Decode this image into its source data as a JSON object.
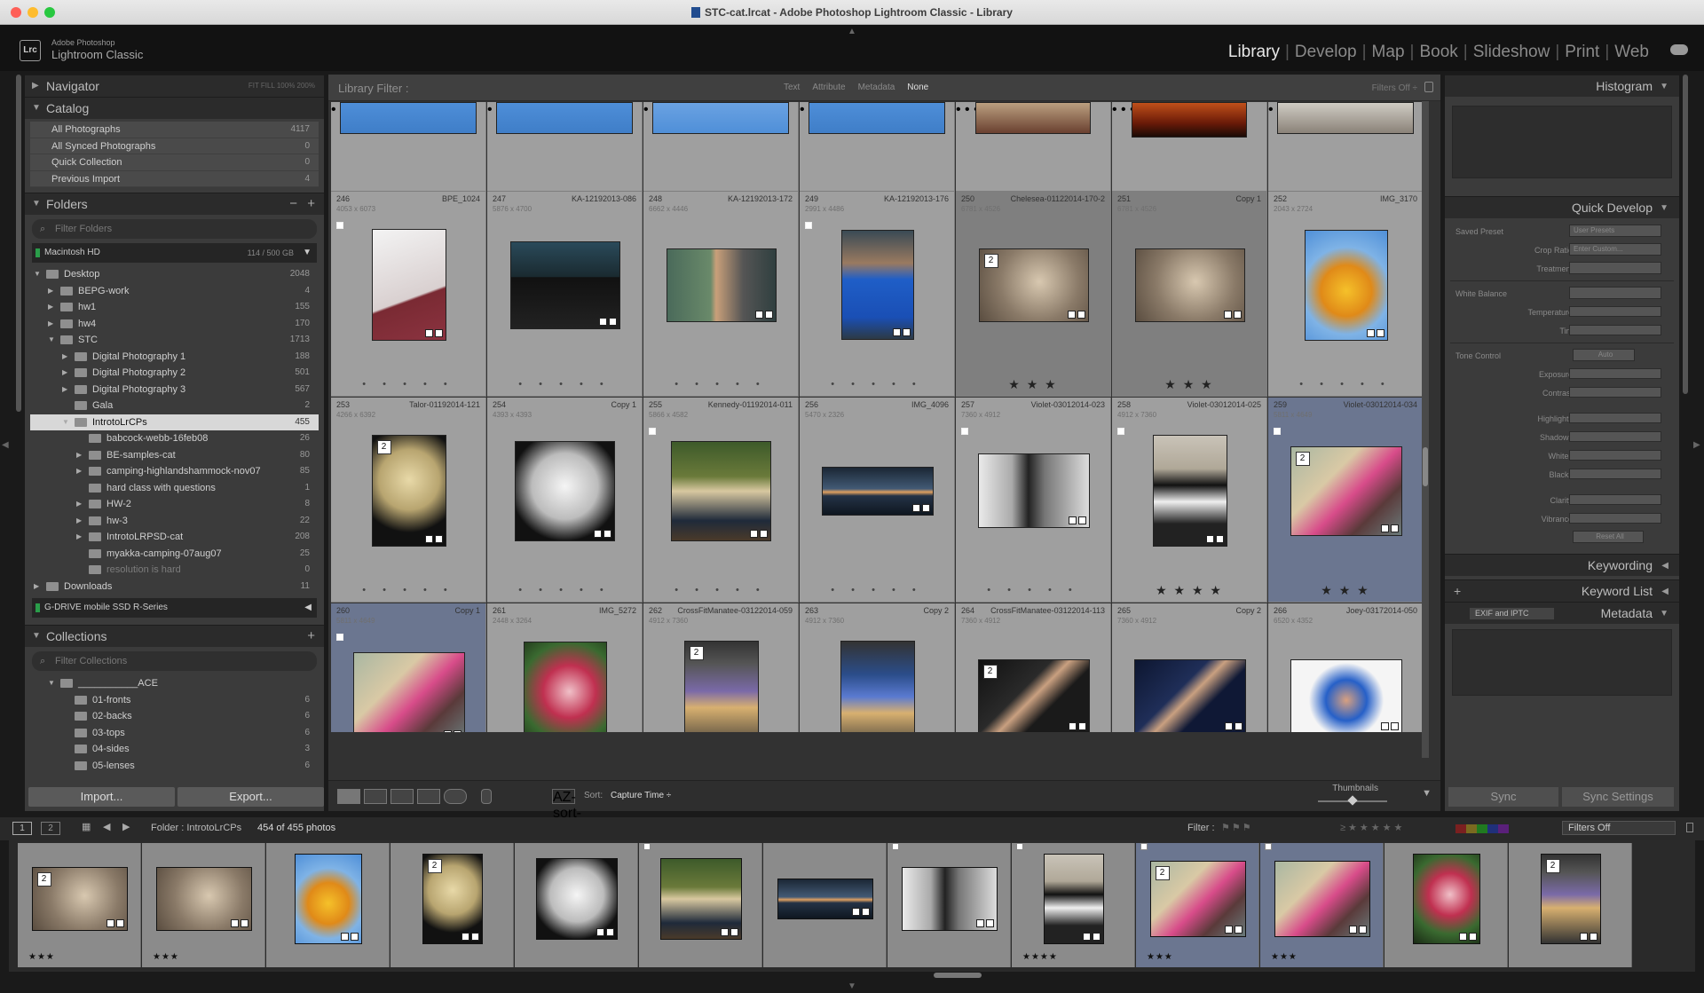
{
  "window": {
    "title": "STC-cat.lrcat - Adobe Photoshop Lightroom Classic - Library"
  },
  "brand": {
    "line1": "Adobe Photoshop",
    "line2": "Lightroom Classic",
    "logo": "Lrc"
  },
  "modules": [
    "Library",
    "Develop",
    "Map",
    "Book",
    "Slideshow",
    "Print",
    "Web"
  ],
  "active_module": "Library",
  "navigator": {
    "label": "Navigator",
    "modes": "FIT   FILL   100%   200%"
  },
  "catalog": {
    "label": "Catalog",
    "items": [
      {
        "label": "All Photographs",
        "count": "4117"
      },
      {
        "label": "All Synced Photographs",
        "count": "0"
      },
      {
        "label": "Quick Collection",
        "count": "0"
      },
      {
        "label": "Previous Import",
        "count": "4"
      }
    ]
  },
  "folders": {
    "label": "Folders",
    "filter_placeholder": "Filter Folders",
    "volume": {
      "name": "Macintosh HD",
      "usage": "114 / 500 GB"
    },
    "items": [
      {
        "label": "Desktop",
        "count": "2048",
        "indent": 0,
        "arrow": "▼"
      },
      {
        "label": "BEPG-work",
        "count": "4",
        "indent": 1,
        "arrow": "▶"
      },
      {
        "label": "hw1",
        "count": "155",
        "indent": 1,
        "arrow": "▶"
      },
      {
        "label": "hw4",
        "count": "170",
        "indent": 1,
        "arrow": "▶"
      },
      {
        "label": "STC",
        "count": "1713",
        "indent": 1,
        "arrow": "▼"
      },
      {
        "label": "Digital Photography 1",
        "count": "188",
        "indent": 2,
        "arrow": "▶"
      },
      {
        "label": "Digital Photography 2",
        "count": "501",
        "indent": 2,
        "arrow": "▶"
      },
      {
        "label": "Digital Photography 3",
        "count": "567",
        "indent": 2,
        "arrow": "▶"
      },
      {
        "label": "Gala",
        "count": "2",
        "indent": 2,
        "arrow": ""
      },
      {
        "label": "IntrotoLrCPs",
        "count": "455",
        "indent": 2,
        "arrow": "▼",
        "selected": true
      },
      {
        "label": "babcock-webb-16feb08",
        "count": "26",
        "indent": 3,
        "arrow": ""
      },
      {
        "label": "BE-samples-cat",
        "count": "80",
        "indent": 3,
        "arrow": "▶"
      },
      {
        "label": "camping-highlandshammock-nov07",
        "count": "85",
        "indent": 3,
        "arrow": "▶"
      },
      {
        "label": "hard class with questions",
        "count": "1",
        "indent": 3,
        "arrow": ""
      },
      {
        "label": "HW-2",
        "count": "8",
        "indent": 3,
        "arrow": "▶"
      },
      {
        "label": "hw-3",
        "count": "22",
        "indent": 3,
        "arrow": "▶"
      },
      {
        "label": "IntrotoLRPSD-cat",
        "count": "208",
        "indent": 3,
        "arrow": "▶"
      },
      {
        "label": "myakka-camping-07aug07",
        "count": "25",
        "indent": 3,
        "arrow": ""
      },
      {
        "label": "resolution is hard",
        "count": "0",
        "indent": 3,
        "arrow": "",
        "dim": true
      },
      {
        "label": "Downloads",
        "count": "11",
        "indent": 0,
        "arrow": "▶"
      }
    ],
    "volume2": {
      "name": "G-DRIVE mobile SSD R-Series"
    }
  },
  "collections": {
    "label": "Collections",
    "filter_placeholder": "Filter Collections",
    "items": [
      {
        "label": "___________ACE",
        "count": "",
        "indent": 0
      },
      {
        "label": "01-fronts",
        "count": "6",
        "indent": 1
      },
      {
        "label": "02-backs",
        "count": "6",
        "indent": 1
      },
      {
        "label": "03-tops",
        "count": "6",
        "indent": 1
      },
      {
        "label": "04-sides",
        "count": "3",
        "indent": 1
      },
      {
        "label": "05-lenses",
        "count": "6",
        "indent": 1
      }
    ]
  },
  "left_buttons": {
    "import": "Import...",
    "export": "Export..."
  },
  "library_filter": {
    "label": "Library Filter :",
    "tabs": [
      "Text",
      "Attribute",
      "Metadata",
      "None"
    ],
    "active_tab": "None",
    "right": "Filters Off ÷"
  },
  "grid": {
    "rows": [
      [
        {
          "num": "246",
          "name": "BPE_1024",
          "dims": "4053 x 6073",
          "stars": "",
          "flag": true,
          "badge": "",
          "thumb": {
            "w": 84,
            "h": 126,
            "bg": "linear-gradient(160deg,#f3f3f3,#d9d0d0 60%,#7a2a33 62%,#8b3340)"
          }
        },
        {
          "num": "247",
          "name": "KA-12192013-086",
          "dims": "5876 x 4700",
          "stars": "",
          "flag": false,
          "badge": "",
          "thumb": {
            "w": 124,
            "h": 99,
            "bg": "linear-gradient(180deg,#2a4a5a,#1a2a30 40%,#111 41%,#222)"
          }
        },
        {
          "num": "248",
          "name": "KA-12192013-172",
          "dims": "6662 x 4446",
          "stars": "",
          "flag": false,
          "badge": "",
          "thumb": {
            "w": 124,
            "h": 83,
            "bg": "linear-gradient(90deg,#4a6a5a,#6a8a6a 40%,#c9a07a 45%,#555 70%,#2f3f3f)"
          }
        },
        {
          "num": "249",
          "name": "KA-12192013-176",
          "dims": "2991 x 4486",
          "stars": "",
          "flag": true,
          "badge": "",
          "thumb": {
            "w": 82,
            "h": 124,
            "bg": "linear-gradient(180deg,#3a4a55,#9a7a60 30%,#1f5ec7 45%,#1a4fb5 80%,#2c3a45)"
          }
        },
        {
          "num": "250",
          "name": "Chelesea-01122014-170-2",
          "dims": "6781 x 4526",
          "stars": "★ ★ ★",
          "flag": false,
          "badge": "2",
          "sel": true,
          "thumb": {
            "w": 124,
            "h": 83,
            "bg": "radial-gradient(circle at 55% 45%,#d8c8b0,#8a7a68 55%,#5a4d40)"
          }
        },
        {
          "num": "251",
          "name": "Copy 1",
          "dims": "6781 x 4526",
          "stars": "★ ★ ★",
          "flag": false,
          "badge": "",
          "sel": true,
          "thumb": {
            "w": 124,
            "h": 83,
            "bg": "radial-gradient(circle at 55% 45%,#d8c8b0,#8a7a68 55%,#5a4d40)"
          }
        },
        {
          "num": "252",
          "name": "IMG_3170",
          "dims": "2043 x 2724",
          "stars": "",
          "flag": false,
          "badge": "",
          "thumb": {
            "w": 94,
            "h": 125,
            "bg": "radial-gradient(circle at 50% 55%,#f5c12a,#e08a18 35%,#7fb3e6 60%,#4f8fd8)"
          }
        }
      ],
      [
        {
          "num": "253",
          "name": "Talor-01192014-121",
          "dims": "4266 x 6392",
          "stars": "",
          "flag": false,
          "badge": "2",
          "thumb": {
            "w": 84,
            "h": 126,
            "bg": "radial-gradient(circle at 50% 40%,#e8d9a8,#b8a570 40%,#111 70%)"
          }
        },
        {
          "num": "254",
          "name": "Copy 1",
          "dims": "4393 x 4393",
          "stars": "",
          "flag": false,
          "badge": "",
          "thumb": {
            "w": 113,
            "h": 113,
            "bg": "radial-gradient(circle at 50% 45%,#f5f5f5,#bcbcbc 45%,#111 75%)"
          }
        },
        {
          "num": "255",
          "name": "Kennedy-01192014-011",
          "dims": "5866 x 4582",
          "stars": "",
          "flag": true,
          "badge": "",
          "thumb": {
            "w": 113,
            "h": 113,
            "bg": "linear-gradient(180deg,#3d5a2a,#6a7a3a 35%,#d8c8a0 50%,#1f2a3a 80%,#4a3a2a)"
          }
        },
        {
          "num": "256",
          "name": "IMG_4096",
          "dims": "5470 x 2326",
          "stars": "",
          "flag": false,
          "badge": "",
          "thumb": {
            "w": 126,
            "h": 55,
            "bg": "linear-gradient(180deg,#1b2735,#425a75 45%,#e0a060 52%,#243246 60%,#0f1720)"
          }
        },
        {
          "num": "257",
          "name": "Violet-03012014-023",
          "dims": "7360 x 4912",
          "stars": "",
          "flag": true,
          "badge": "",
          "thumb": {
            "w": 126,
            "h": 84,
            "bg": "linear-gradient(90deg,#eaeaea,#aaa 30%,#222 45%,#777 60%,#ddd)"
          }
        },
        {
          "num": "258",
          "name": "Violet-03012014-025",
          "dims": "4912 x 7360",
          "stars": "★ ★ ★ ★",
          "flag": true,
          "badge": "",
          "thumb": {
            "w": 84,
            "h": 126,
            "bg": "linear-gradient(180deg,#c9c3b8,#b0a898 30%,#111 45%,#efefef 60%,#222 80%)"
          }
        },
        {
          "num": "259",
          "name": "Violet-03012014-034",
          "dims": "5811 x 4649",
          "stars": "★ ★ ★",
          "flag": true,
          "badge": "2",
          "sel2": true,
          "thumb": {
            "w": 126,
            "h": 101,
            "bg": "linear-gradient(135deg,#a9b7a2,#d9c9a5 35%,#d84c8a 55%,#5a3a3a 75%,#6a7a7a)"
          }
        }
      ],
      [
        {
          "num": "260",
          "name": "Copy 1",
          "dims": "5811 x 4649",
          "stars": "",
          "flag": true,
          "badge": "",
          "sel2": true,
          "thumb": {
            "w": 126,
            "h": 101,
            "bg": "linear-gradient(135deg,#a9b7a2,#d9c9a5 35%,#d84c8a 55%,#5a3a3a 75%,#6a7a7a)"
          }
        },
        {
          "num": "261",
          "name": "IMG_5272",
          "dims": "2448 x 3264",
          "stars": "",
          "flag": false,
          "badge": "",
          "thumb": {
            "w": 94,
            "h": 125,
            "bg": "radial-gradient(circle at 55% 45%,#f0c0c8,#c03050 35%,#3a6a30 65%,#1a2a15)"
          }
        },
        {
          "num": "262",
          "name": "CrossFitManatee-03122014-059",
          "dims": "4912 x 7360",
          "stars": "",
          "flag": false,
          "badge": "2",
          "thumb": {
            "w": 84,
            "h": 126,
            "bg": "linear-gradient(180deg,#333,#555 20%,#7a6aa8 45%,#d8b070 60%,#333)"
          }
        },
        {
          "num": "263",
          "name": "Copy 2",
          "dims": "4912 x 7360",
          "stars": "",
          "flag": false,
          "badge": "",
          "thumb": {
            "w": 84,
            "h": 126,
            "bg": "linear-gradient(180deg,#333,#2b4d8a 30%,#5a7ad0 50%,#d8b070 65%,#333)"
          }
        },
        {
          "num": "264",
          "name": "CrossFitManatee-03122014-113",
          "dims": "7360 x 4912",
          "stars": "",
          "flag": false,
          "badge": "2",
          "thumb": {
            "w": 126,
            "h": 84,
            "bg": "linear-gradient(135deg,#111,#2a2a2a 40%,#c9a080 50%,#1a1a1a 65%)"
          }
        },
        {
          "num": "265",
          "name": "Copy 2",
          "dims": "7360 x 4912",
          "stars": "",
          "flag": false,
          "badge": "",
          "thumb": {
            "w": 126,
            "h": 84,
            "bg": "linear-gradient(135deg,#0d1630,#1f2e58 40%,#c9a080 50%,#0f1835 65%)"
          }
        },
        {
          "num": "266",
          "name": "Joey-03172014-050",
          "dims": "6520 x 4352",
          "stars": "",
          "flag": false,
          "badge": "",
          "thumb": {
            "w": 126,
            "h": 84,
            "bg": "radial-gradient(circle at 50% 55%,#d8a080,#2660c8 30%,#f5f5f5 55%)"
          }
        }
      ]
    ],
    "top_thumbs": [
      "linear-gradient(180deg,#4e8ed8,#3f7ec8)",
      "linear-gradient(180deg,#4e8ed8,#3f7ec8)",
      "linear-gradient(180deg,#6aa2e2,#4f8fd8)",
      "linear-gradient(180deg,#4e8ed8,#3f7ec8)",
      "linear-gradient(180deg,#bba080,#6a4030)",
      "linear-gradient(180deg,#c0501a,#6a1a08 60%,#1a0a05)",
      "linear-gradient(180deg,#d0ccc4,#8a8278)"
    ]
  },
  "toolbar": {
    "sort_label": "Sort:",
    "sort_value": "Capture Time ÷",
    "thumbnails_label": "Thumbnails",
    "sort_icon": "AZ-sort-icon"
  },
  "histogram": {
    "label": "Histogram"
  },
  "quick_develop": {
    "label": "Quick Develop",
    "saved_preset_label": "Saved Preset",
    "saved_preset_value": "User Presets",
    "crop_label": "Crop Ratio",
    "crop_value": "Enter Custom...",
    "treatment_label": "Treatment",
    "wb_label": "White Balance",
    "temperature_label": "Temperature",
    "tint_label": "Tint",
    "tone_label": "Tone Control",
    "auto_label": "Auto",
    "tone_items": [
      "Exposure",
      "Contrast",
      "Highlights",
      "Shadows",
      "Whites",
      "Blacks",
      "Clarity",
      "Vibrance"
    ],
    "reset_label": "Reset All"
  },
  "keywording": {
    "label": "Keywording"
  },
  "keyword_list": {
    "label": "Keyword List"
  },
  "metadata": {
    "label": "Metadata",
    "preset": "EXIF and IPTC"
  },
  "right_buttons": {
    "sync": "Sync",
    "sync_settings": "Sync Settings"
  },
  "filmstrip_bar": {
    "page1": "1",
    "page2": "2",
    "source": "Folder : IntrotoLrCPs",
    "count": "454 of 455 photos",
    "filter_label": "Filter :",
    "filter_value": "Filters Off"
  },
  "filmstrip": [
    {
      "bg": "radial-gradient(circle at 55% 45%,#d8c8b0,#8a7a68 55%,#5a4d40)",
      "w": 108,
      "h": 72,
      "stars": "★★★",
      "badge": "2"
    },
    {
      "bg": "radial-gradient(circle at 55% 45%,#d8c8b0,#8a7a68 55%,#5a4d40)",
      "w": 108,
      "h": 72,
      "stars": "★★★",
      "badge": ""
    },
    {
      "bg": "radial-gradient(circle at 50% 55%,#f5c12a,#e08a18 35%,#7fb3e6 60%,#4f8fd8)",
      "w": 76,
      "h": 102,
      "stars": "",
      "badge": ""
    },
    {
      "bg": "radial-gradient(circle at 50% 40%,#e8d9a8,#b8a570 40%,#111 70%)",
      "w": 68,
      "h": 102,
      "stars": "",
      "badge": "2"
    },
    {
      "bg": "radial-gradient(circle at 50% 45%,#f5f5f5,#bcbcbc 45%,#111 75%)",
      "w": 92,
      "h": 92,
      "stars": "",
      "badge": ""
    },
    {
      "bg": "linear-gradient(180deg,#3d5a2a,#6a7a3a 35%,#d8c8a0 50%,#1f2a3a 80%,#4a3a2a)",
      "w": 92,
      "h": 92,
      "stars": "",
      "badge": "",
      "flag": true
    },
    {
      "bg": "linear-gradient(180deg,#1b2735,#425a75 45%,#e0a060 52%,#243246 60%,#0f1720)",
      "w": 108,
      "h": 46,
      "stars": "",
      "badge": ""
    },
    {
      "bg": "linear-gradient(90deg,#eaeaea,#aaa 30%,#222 45%,#777 60%,#ddd)",
      "w": 108,
      "h": 72,
      "stars": "",
      "badge": "",
      "flag": true
    },
    {
      "bg": "linear-gradient(180deg,#c9c3b8,#b0a898 30%,#111 45%,#efefef 60%,#222 80%)",
      "w": 68,
      "h": 102,
      "stars": "★★★★",
      "badge": "",
      "flag": true
    },
    {
      "bg": "linear-gradient(135deg,#a9b7a2,#d9c9a5 35%,#d84c8a 55%,#5a3a3a 75%,#6a7a7a)",
      "w": 108,
      "h": 86,
      "stars": "★★★",
      "badge": "2",
      "sel2": true,
      "flag": true
    },
    {
      "bg": "linear-gradient(135deg,#a9b7a2,#d9c9a5 35%,#d84c8a 55%,#5a3a3a 75%,#6a7a7a)",
      "w": 108,
      "h": 86,
      "stars": "★★★",
      "badge": "",
      "sel2": true,
      "flag": true
    },
    {
      "bg": "radial-gradient(circle at 55% 45%,#f0c0c8,#c03050 35%,#3a6a30 65%,#1a2a15)",
      "w": 76,
      "h": 102,
      "stars": "",
      "badge": ""
    },
    {
      "bg": "linear-gradient(180deg,#333,#555 20%,#7a6aa8 45%,#d8b070 60%,#333)",
      "w": 68,
      "h": 102,
      "stars": "",
      "badge": "2"
    }
  ]
}
